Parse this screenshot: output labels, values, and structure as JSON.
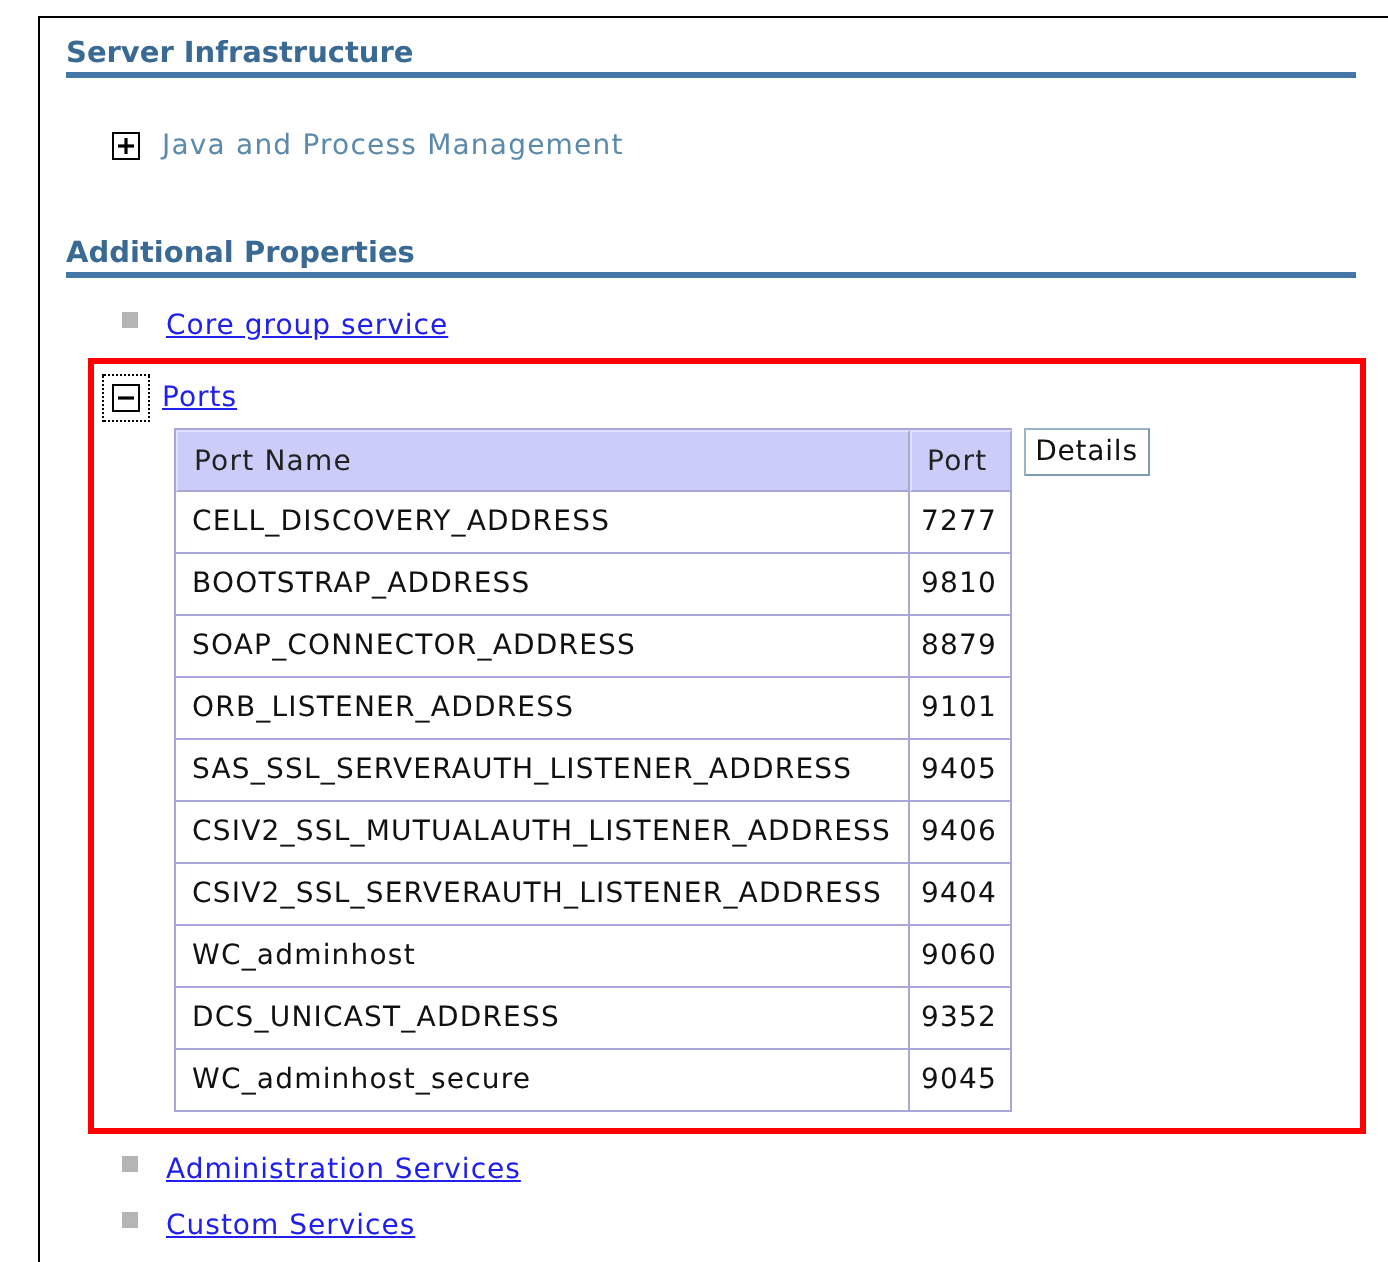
{
  "sections": [
    {
      "title": "Server Infrastructure",
      "items": [
        {
          "kind": "tree",
          "label": "Java and Process Management",
          "link": false,
          "expanded": false,
          "focused": false,
          "highlighted": false
        }
      ]
    },
    {
      "title": "Additional Properties",
      "items": [
        {
          "kind": "link",
          "label": "Core group service"
        },
        {
          "kind": "tree",
          "label": "Ports",
          "link": true,
          "expanded": true,
          "focused": true,
          "highlighted": true,
          "table": {
            "columns": [
              "Port Name",
              "Port"
            ],
            "rows": [
              [
                "CELL_DISCOVERY_ADDRESS",
                "7277"
              ],
              [
                "BOOTSTRAP_ADDRESS",
                "9810"
              ],
              [
                "SOAP_CONNECTOR_ADDRESS",
                "8879"
              ],
              [
                "ORB_LISTENER_ADDRESS",
                "9101"
              ],
              [
                "SAS_SSL_SERVERAUTH_LISTENER_ADDRESS",
                "9405"
              ],
              [
                "CSIV2_SSL_MUTUALAUTH_LISTENER_ADDRESS",
                "9406"
              ],
              [
                "CSIV2_SSL_SERVERAUTH_LISTENER_ADDRESS",
                "9404"
              ],
              [
                "WC_adminhost",
                "9060"
              ],
              [
                "DCS_UNICAST_ADDRESS",
                "9352"
              ],
              [
                "WC_adminhost_secure",
                "9045"
              ]
            ]
          },
          "button": "Details"
        },
        {
          "kind": "link",
          "label": "Administration Services"
        },
        {
          "kind": "link",
          "label": "Custom Services"
        }
      ]
    }
  ]
}
